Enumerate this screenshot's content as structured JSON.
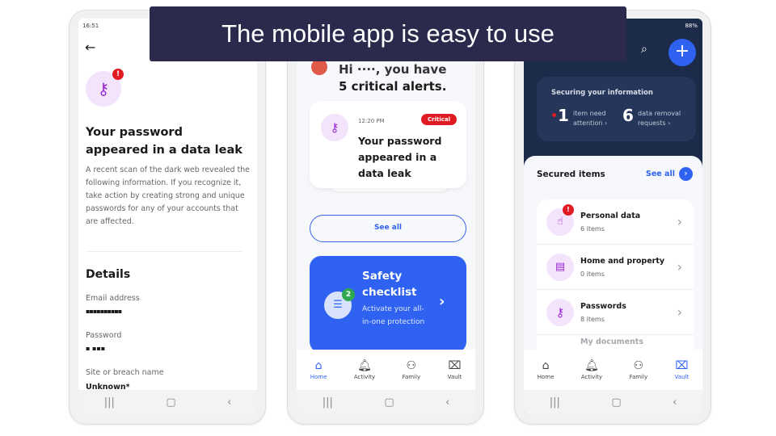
{
  "banner": {
    "title": "The mobile app is easy to use"
  },
  "left": {
    "status_time": "16:51",
    "title": "Your password appeared in a data leak",
    "description": "A recent scan of the dark web revealed the following information. If you recognize it, take action by creating strong and unique passwords for any of your accounts that are affected.",
    "details_heading": "Details",
    "fields": [
      {
        "label": "Email address",
        "value": "▪▪▪▪▪▪▪▪▪▪"
      },
      {
        "label": "Password",
        "value": "▪ ▪▪▪"
      },
      {
        "label": "Site or breach name",
        "value": "Unknown*"
      }
    ]
  },
  "middle": {
    "headline_partial": "Hi ····, you have",
    "headline": "5 critical alerts.",
    "alert": {
      "time": "12:20 PM",
      "badge": "Critical",
      "title": "Your password appeared in a data leak"
    },
    "see_all": "See all",
    "checklist": {
      "title": "Safety checklist",
      "subtitle": "Activate your all-in-one protection",
      "count": "2"
    },
    "tabs": [
      {
        "label": "Home",
        "active": true
      },
      {
        "label": "Activity"
      },
      {
        "label": "Family"
      },
      {
        "label": "Vault"
      }
    ]
  },
  "right": {
    "status": "88%",
    "summary": {
      "title": "Securing your information",
      "attention_count": "1",
      "attention_label": "item need attention ›",
      "removal_count": "6",
      "removal_label": "data removal requests ›"
    },
    "secured": {
      "title": "Secured items",
      "see_all": "See all",
      "items": [
        {
          "name": "Personal data",
          "count": "6 items",
          "alert": true
        },
        {
          "name": "Home and property",
          "count": "0 items"
        },
        {
          "name": "Passwords",
          "count": "8 items"
        },
        {
          "name": "My documents",
          "count": ""
        }
      ]
    },
    "tabs": [
      {
        "label": "Home"
      },
      {
        "label": "Activity"
      },
      {
        "label": "Family"
      },
      {
        "label": "Vault",
        "active": true
      }
    ]
  },
  "colors": {
    "banner": "#2b2a4c",
    "accent": "#2f62f0",
    "critical": "#e01b24",
    "navy": "#1d2b4b",
    "purple": "#9b2bd0"
  }
}
